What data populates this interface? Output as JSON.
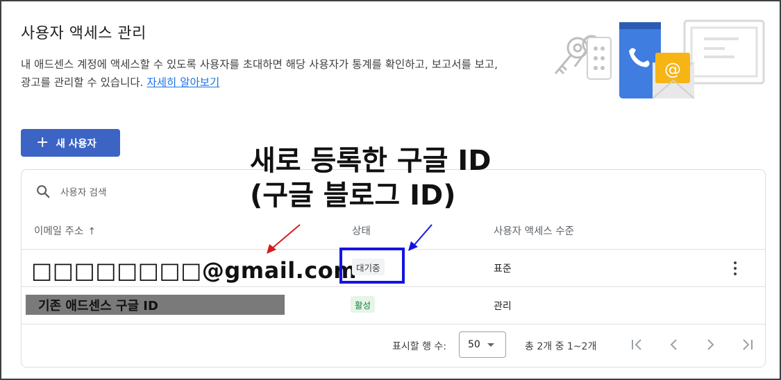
{
  "header": {
    "title": "사용자 액세스 관리",
    "description": "내 애드센스 계정에 액세스할 수 있도록 사용자를 초대하면 해당 사용자가 통계를 확인하고, 보고서를 보고, 광고를 관리할 수 있습니다.",
    "learn_more_link": "자세히 알아보기"
  },
  "toolbar": {
    "new_user_button": "새 사용자",
    "plus_icon": "add-icon"
  },
  "search": {
    "placeholder": "사용자 검색",
    "icon": "search-icon"
  },
  "table": {
    "columns": {
      "email": "이메일 주소",
      "sort_indicator": "↑",
      "status": "상태",
      "access_level": "사용자 액세스 수준"
    },
    "rows": [
      {
        "email": "□□□□□□□□@gmail.com",
        "status": "대기중",
        "access_level": "표준",
        "menu_icon": "more-vert-icon"
      },
      {
        "email": "기존 애드센스 구글 ID",
        "status": "활성",
        "access_level": "관리"
      }
    ]
  },
  "pagination": {
    "rows_per_page_label": "표시할 행 수:",
    "rows_per_page_value": "50",
    "range_text": "총 2개 중 1~2개"
  },
  "annotation": {
    "line1": "새로 등록한 구글 ID",
    "line2": "(구글 블로그 ID)",
    "arrow_colors": {
      "red": "#d61c1c",
      "blue": "#1414e0"
    }
  },
  "colors": {
    "primary_button": "#3c64c4",
    "link": "#1a73e8",
    "active_chip_bg": "#e6f4ea",
    "active_chip_text": "#188038",
    "pending_chip_bg": "#f1f3f4",
    "highlight_box": "#1414e0",
    "redacted_bar": "#7a7a7a"
  }
}
